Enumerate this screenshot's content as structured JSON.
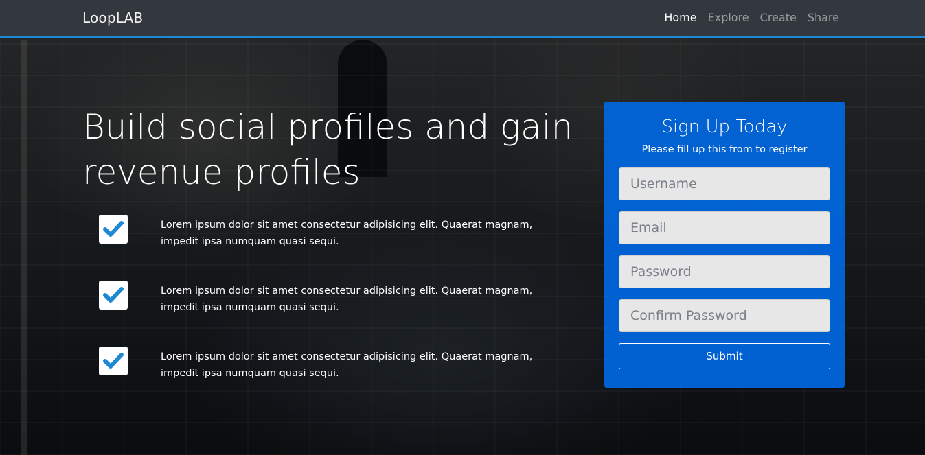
{
  "navbar": {
    "brand": "LoopLAB",
    "links": [
      {
        "label": "Home"
      },
      {
        "label": "Explore"
      },
      {
        "label": "Create"
      },
      {
        "label": "Share"
      }
    ]
  },
  "hero": {
    "title": "Build social profiles and gain revenue profiles",
    "features": [
      {
        "icon": "checkmark-icon",
        "text": "Lorem ipsum dolor sit amet consectetur adipisicing elit. Quaerat magnam, impedit ipsa numquam quasi sequi."
      },
      {
        "icon": "checkmark-icon",
        "text": "Lorem ipsum dolor sit amet consectetur adipisicing elit. Quaerat magnam, impedit ipsa numquam quasi sequi."
      },
      {
        "icon": "checkmark-icon",
        "text": "Lorem ipsum dolor sit amet consectetur adipisicing elit. Quaerat magnam, impedit ipsa numquam quasi sequi."
      }
    ]
  },
  "signup": {
    "title": "Sign Up Today",
    "subtitle": "Please fill up this from to register",
    "username_placeholder": "Username",
    "email_placeholder": "Email",
    "password_placeholder": "Password",
    "confirm_password_placeholder": "Confirm Password",
    "submit_label": "Submit"
  },
  "colors": {
    "accent": "#1e88d2",
    "card": "#0067e0",
    "check": "#1e88d2"
  }
}
